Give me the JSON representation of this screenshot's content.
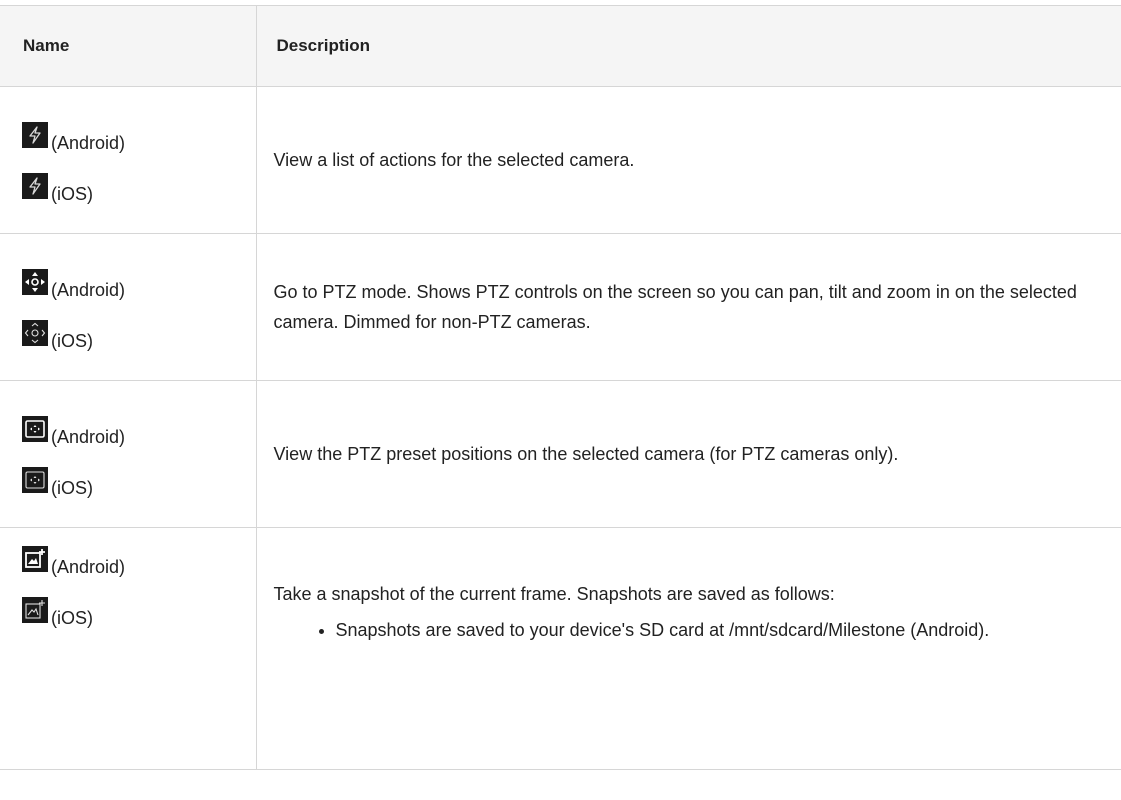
{
  "table": {
    "headers": {
      "name": "Name",
      "description": "Description"
    },
    "rows": [
      {
        "icons": [
          {
            "icon": "lightning-icon",
            "platform": "(Android)"
          },
          {
            "icon": "lightning-icon",
            "platform": "(iOS)"
          }
        ],
        "description": "View a list of actions for the selected camera."
      },
      {
        "icons": [
          {
            "icon": "ptz-move-icon",
            "platform": "(Android)"
          },
          {
            "icon": "ptz-move-icon",
            "platform": "(iOS)"
          }
        ],
        "description": "Go to PTZ mode. Shows PTZ controls on the screen so you can pan, tilt and zoom in on the selected camera. Dimmed for non-PTZ cameras."
      },
      {
        "icons": [
          {
            "icon": "ptz-preset-icon",
            "platform": "(Android)"
          },
          {
            "icon": "ptz-preset-icon",
            "platform": "(iOS)"
          }
        ],
        "description": "View the PTZ preset positions on the selected camera (for PTZ cameras only)."
      },
      {
        "icons": [
          {
            "icon": "snapshot-icon",
            "platform": "(Android)"
          },
          {
            "icon": "snapshot-icon",
            "platform": "(iOS)"
          }
        ],
        "description": "Take a snapshot of the current frame. Snapshots are saved as follows:",
        "bullets": [
          "Snapshots are saved to your device's SD card at /mnt/sdcard/Milestone (Android)."
        ]
      }
    ]
  },
  "colors": {
    "border": "#d6d6d6",
    "header_bg": "#f5f5f5",
    "icon_bg": "#1a1a1a"
  }
}
